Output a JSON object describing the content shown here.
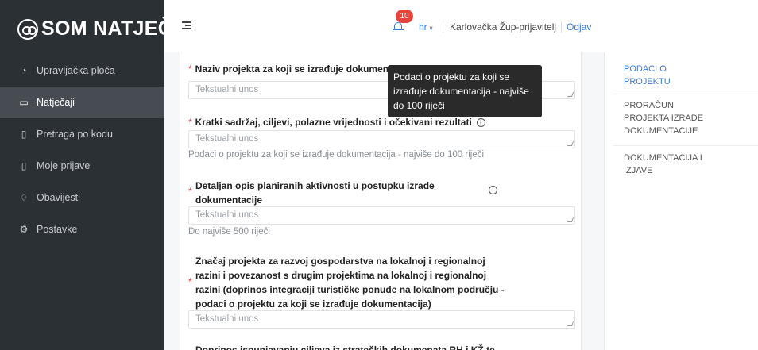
{
  "app": {
    "logo_text": "SOM NATJEČAJI"
  },
  "sidebar": {
    "items": [
      {
        "label": "Upravljačka ploča",
        "icon": "dashboard-icon",
        "glyph": "◔"
      },
      {
        "label": "Natječaji",
        "icon": "folder-icon",
        "glyph": "▭"
      },
      {
        "label": "Pretraga po kodu",
        "icon": "document-icon",
        "glyph": "▯"
      },
      {
        "label": "Moje prijave",
        "icon": "file-icon",
        "glyph": "▯"
      },
      {
        "label": "Obavijesti",
        "icon": "bell-icon",
        "glyph": "♢"
      },
      {
        "label": "Postavke",
        "icon": "gear-icon",
        "glyph": "⚙"
      }
    ],
    "active_index": 1
  },
  "header": {
    "notification_count": "10",
    "language": "hr",
    "user": "Karlovačka Žup-prijavitelj",
    "logout": "Odjav"
  },
  "form": {
    "field1": {
      "label": "Naziv projekta za koji se izrađuje dokumenta",
      "placeholder": "Tekstualni unos"
    },
    "field2": {
      "label": "Kratki sadržaj, ciljevi, polazne vrijednosti i očekivani rezultati",
      "placeholder": "Tekstualni unos",
      "help": "Podaci o projektu za koji se izrađuje dokumentacija - najviše do 100 riječi"
    },
    "field3": {
      "label_line1": "Detaljan opis planiranih aktivnosti u postupku izrade",
      "label_line2": "dokumentacije",
      "placeholder": "Tekstualni unos",
      "help": "Do najviše 500 riječi"
    },
    "field4": {
      "label_line1": "Značaj projekta za razvoj gospodarstva na lokalnoj i regionalnoj",
      "label_line2": "razini i povezanost s drugim projektima na lokalnoj i regionalnoj",
      "label_line3": "razini (doprinos integraciji turističke ponude na lokalnom području -",
      "label_line4": "podaci o projektu za koji se izrađuje dokumentacija)",
      "placeholder": "Tekstualni unos"
    },
    "field5": {
      "label_partial": "Doprinos ispunjavanju ciljeva iz strateških dokumenata RH i KŽ te"
    },
    "required_mark": "*",
    "info_glyph": "i"
  },
  "tooltip": {
    "line1": "Podaci o projektu za koji se",
    "line2": "izrađuje dokumentacija - najviše",
    "line3": "do 100 riječi"
  },
  "sections_nav": [
    {
      "line1": "PODACI O",
      "line2": "PROJEKTU"
    },
    {
      "line1": "PRORAČUN",
      "line2": "PROJEKTA IZRADE",
      "line3": "DOKUMENTACIJE"
    },
    {
      "line1": "DOKUMENTACIJA I",
      "line2": "IZJAVE"
    }
  ],
  "colors": {
    "sidebar_bg": "#2b3035",
    "active_bg": "#474c52",
    "accent": "#3a7bd5",
    "badge": "#e9433b",
    "required": "#e14545"
  }
}
